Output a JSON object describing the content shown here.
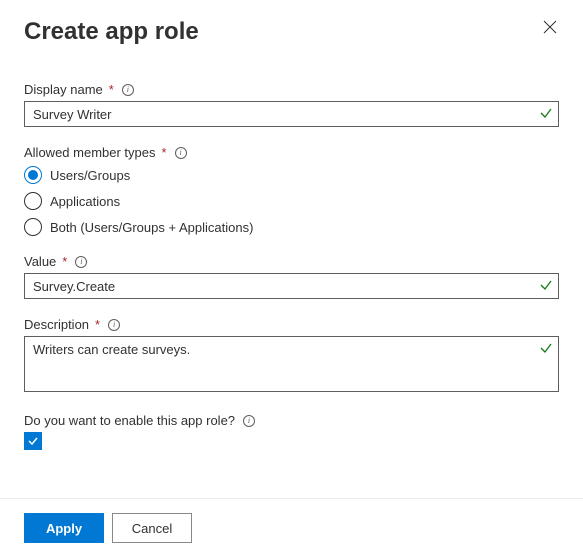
{
  "header": {
    "title": "Create app role"
  },
  "fields": {
    "displayName": {
      "label": "Display name",
      "value": "Survey Writer"
    },
    "allowedMemberTypes": {
      "label": "Allowed member types",
      "options": [
        {
          "label": "Users/Groups",
          "selected": true
        },
        {
          "label": "Applications",
          "selected": false
        },
        {
          "label": "Both (Users/Groups + Applications)",
          "selected": false
        }
      ]
    },
    "value": {
      "label": "Value",
      "value": "Survey.Create"
    },
    "description": {
      "label": "Description",
      "value": "Writers can create surveys."
    },
    "enable": {
      "label": "Do you want to enable this app role?",
      "checked": true
    }
  },
  "footer": {
    "apply": "Apply",
    "cancel": "Cancel"
  }
}
